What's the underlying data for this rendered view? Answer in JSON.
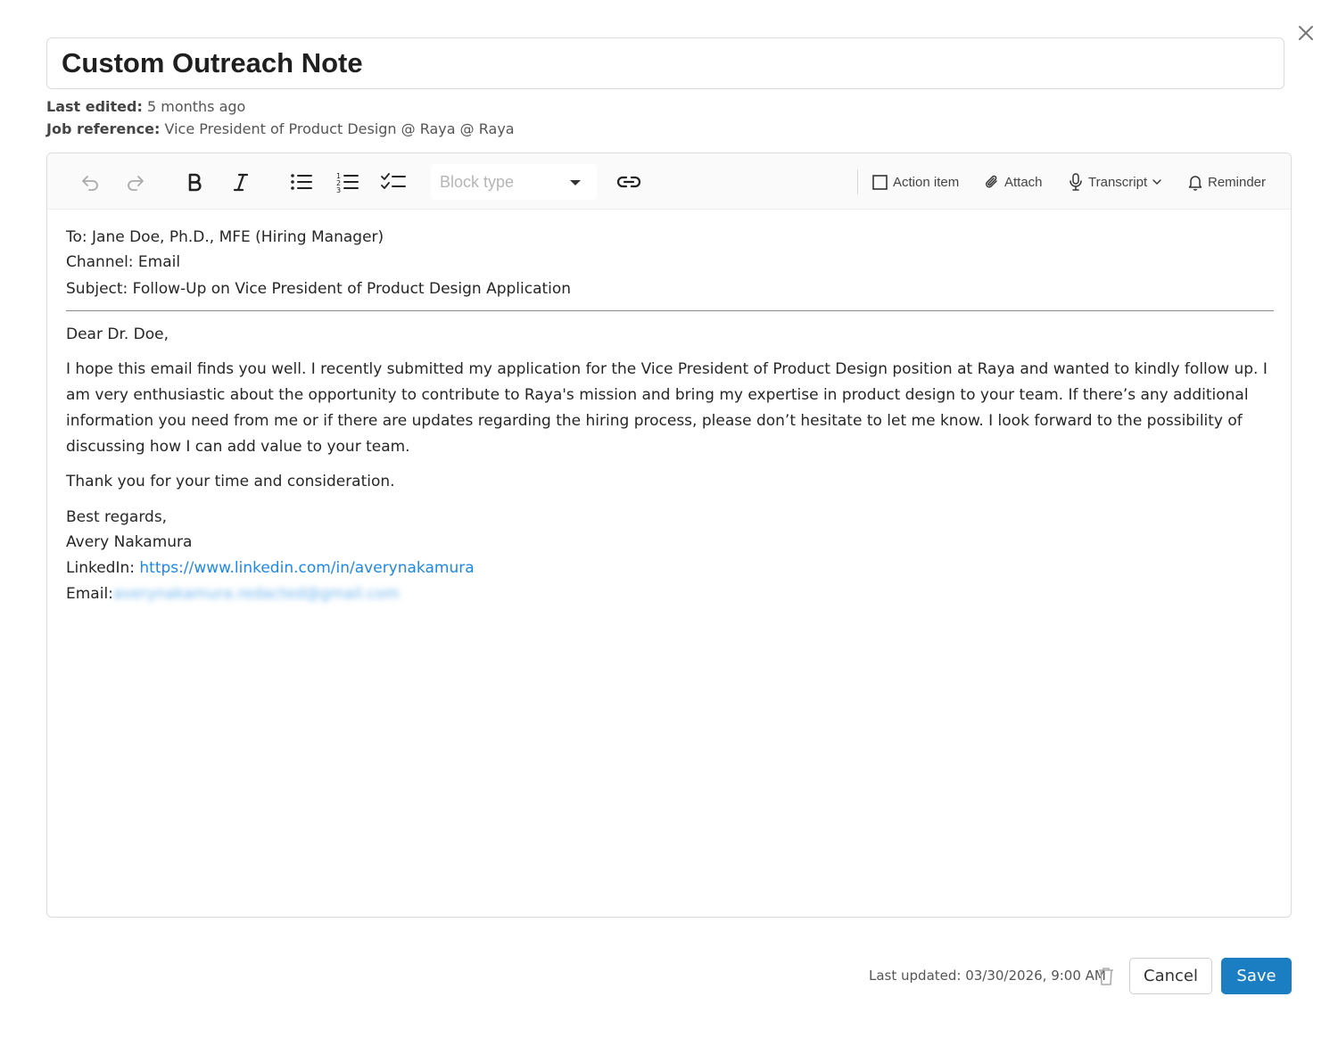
{
  "dialog": {
    "title": "Custom Outreach Note",
    "last_edited_label": "Last edited:",
    "last_edited_value": "5 months ago",
    "job_reference_label": "Job reference:",
    "job_reference_value": "Vice President of Product Design @ Raya @ Raya"
  },
  "toolbar": {
    "block_type_placeholder": "Block type",
    "action_item_label": "Action item",
    "attach_label": "Attach",
    "transcript_label": "Transcript",
    "reminder_label": "Reminder",
    "icons": [
      "undo-icon",
      "redo-icon",
      "bold-icon",
      "italic-icon",
      "bullet-list-icon",
      "numbered-list-icon",
      "checklist-icon",
      "link-icon",
      "checkbox-icon",
      "paperclip-icon",
      "microphone-icon",
      "chevron-down-icon",
      "bell-icon"
    ]
  },
  "note": {
    "to_line": "To: Jane Doe, Ph.D., MFE (Hiring Manager)",
    "channel_line": "Channel: Email",
    "subject_line": "Subject: Follow-Up on Vice President of Product Design Application",
    "greeting": "Dear Dr. Doe,",
    "body": "I hope this email finds you well. I recently submitted my application for the Vice President of Product Design position at Raya and wanted to kindly follow up. I am very enthusiastic about the opportunity to contribute to Raya's mission and bring my expertise in product design to your team. If there’s any additional information you need from me or if there are updates regarding the hiring process, please don’t hesitate to let me know. I look forward to the possibility of discussing how I can add value to your team.",
    "thanks": "Thank you for your time and consideration.",
    "closing": "Best regards,",
    "name": "Avery Nakamura",
    "linkedin_label": "LinkedIn: ",
    "linkedin_url": "https://www.linkedin.com/in/averynakamura",
    "email_label": "Email:",
    "email_value": "averynakamura.redacted@gmail.com"
  },
  "footer": {
    "last_updated": "Last updated: 03/30/2026, 9:00 AM",
    "cancel_label": "Cancel",
    "save_label": "Save",
    "save_color": "#1b7ec2",
    "link_color": "#1e88e5"
  }
}
